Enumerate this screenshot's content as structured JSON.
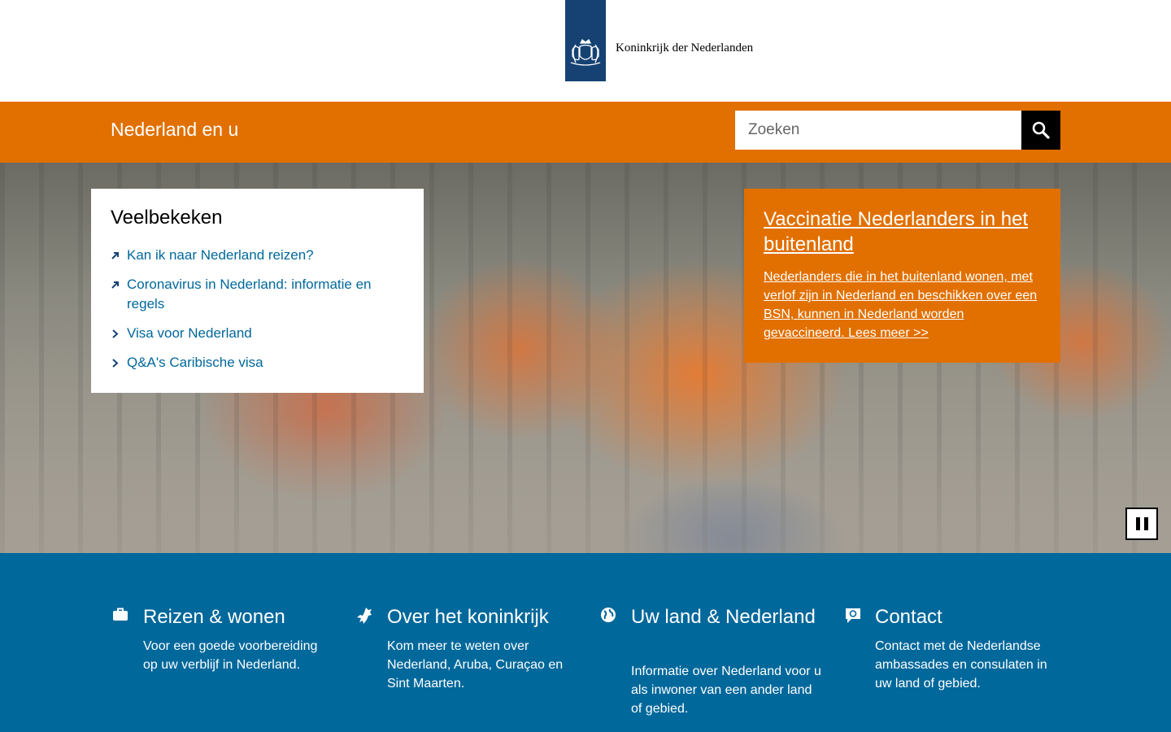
{
  "header": {
    "logo_text": "Koninkrijk der Nederlanden",
    "brand_color": "#154273"
  },
  "nav": {
    "site_title": "Nederland en u",
    "search_placeholder": "Zoeken",
    "search_icon": "magnifier-icon",
    "accent_color": "#e17000"
  },
  "most_viewed": {
    "heading": "Veelbekeken",
    "items": [
      {
        "label": "Kan ik naar Nederland reizen?",
        "icon": "external-arrow-icon"
      },
      {
        "label": "Coronavirus in Nederland: informatie en regels",
        "icon": "external-arrow-icon"
      },
      {
        "label": "Visa voor Nederland",
        "icon": "chevron-right-icon"
      },
      {
        "label": "Q&A's Caribische visa",
        "icon": "chevron-right-icon"
      }
    ]
  },
  "promo": {
    "title": "Vaccinatie Nederlanders in het buitenland",
    "body": "Nederlanders die in het buitenland wonen, met verlof zijn in Nederland en beschikken over een BSN, kunnen in Nederland worden gevaccineerd. Lees meer >>"
  },
  "hero": {
    "pause_icon": "pause-icon"
  },
  "categories": [
    {
      "title": "Reizen & wonen",
      "desc": "Voor een goede voorbereiding op uw verblijf in Nederland.",
      "icon": "suitcase-icon"
    },
    {
      "title": "Over het koninkrijk",
      "desc": "Kom meer te weten over Nederland, Aruba, Curaçao en Sint Maarten.",
      "icon": "lion-icon"
    },
    {
      "title": "Uw land & Nederland",
      "desc": "Informatie over Nederland voor u als inwoner van een ander land of gebied.",
      "icon": "globe-icon"
    },
    {
      "title": "Contact",
      "desc": "Contact met de Nederlandse ambassades en consulaten in uw land of gebied.",
      "icon": "speech-bubble-icon"
    }
  ],
  "footer_color": "#01689b"
}
